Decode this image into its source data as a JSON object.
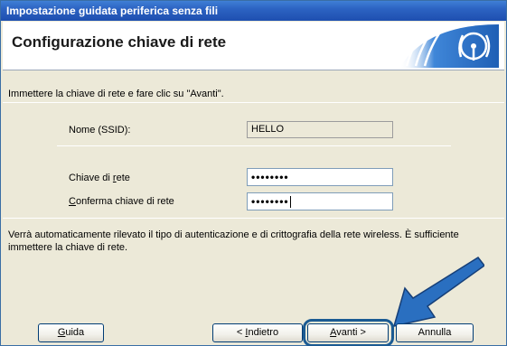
{
  "window": {
    "title": "Impostazione guidata periferica senza fili"
  },
  "header": {
    "title": "Configurazione chiave di rete",
    "logo_icon": "wireless-signal-icon"
  },
  "instruction": "Immettere la chiave di rete e fare clic su \"Avanti\".",
  "fields": {
    "ssid_label": "Nome (SSID):",
    "ssid_value": "HELLO",
    "key_label_pre": "Chiave di ",
    "key_label_mnemonic": "r",
    "key_label_post": "ete",
    "key_value": "••••••••",
    "confirm_label_mnemonic": "C",
    "confirm_label_post": "onferma chiave di rete",
    "confirm_value": "••••••••"
  },
  "note": "Verrà automaticamente rilevato il tipo di autenticazione e di crittografia della rete wireless. È sufficiente immettere la chiave di rete.",
  "buttons": {
    "help_mnemonic": "G",
    "help_rest": "uida",
    "back_pre": "< ",
    "back_mnemonic": "I",
    "back_rest": "ndietro",
    "next_mnemonic": "A",
    "next_rest": "vanti >",
    "cancel": "Annulla"
  },
  "colors": {
    "title_bar": "#2c63c2",
    "focus_ring": "#1b5b93",
    "arrow": "#2a6fc0"
  }
}
